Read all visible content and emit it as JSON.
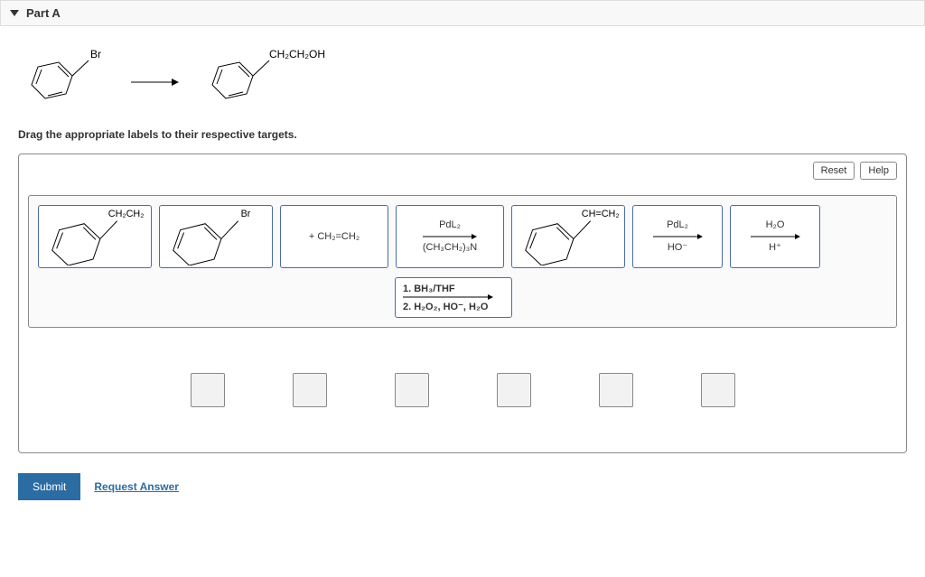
{
  "header": {
    "title": "Part A"
  },
  "reaction": {
    "reactant_label": "Br",
    "product_label": "CH₂CH₂OH"
  },
  "instruction": "Drag the appropriate labels to their respective targets.",
  "panel": {
    "reset": "Reset",
    "help": "Help"
  },
  "labels": {
    "tile1_sub": "CH₂CH₂",
    "tile2_sub": "Br",
    "tile3": "+  CH₂=CH₂",
    "tile4_top": "PdL₂",
    "tile4_bottom": "(CH₃CH₂)₃N",
    "tile5_sub": "CH=CH₂",
    "tile6_top": "PdL₂",
    "tile6_bottom": "HO⁻",
    "tile7_top": "H₂O",
    "tile7_bottom": "H⁺",
    "tile8_line1": "1. BH₃/THF",
    "tile8_line2": "2. H₂O₂, HO⁻, H₂O"
  },
  "actions": {
    "submit": "Submit",
    "request": "Request Answer"
  }
}
